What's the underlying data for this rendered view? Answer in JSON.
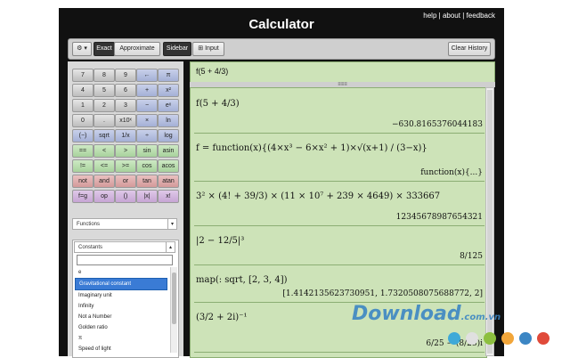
{
  "header": {
    "title": "Calculator",
    "links": [
      "help",
      "about",
      "feedback"
    ],
    "separator": "|"
  },
  "toolbar": {
    "gear": "⚙ ▾",
    "exact": "Exact",
    "approximate": "Approximate",
    "sidebar": "Sidebar",
    "input": "⊞ Input",
    "clear_history": "Clear History"
  },
  "keypad": {
    "keys": [
      "7",
      "8",
      "9",
      "←",
      "π",
      "4",
      "5",
      "6",
      "+",
      "x²",
      "1",
      "2",
      "3",
      "−",
      "eˣ",
      "0",
      ".",
      "x10ˣ",
      "×",
      "ln",
      "(−)",
      "sqrt",
      "1/x",
      "÷",
      "log",
      "==",
      "<",
      ">",
      "sin",
      "asin",
      "!=",
      "<=",
      ">=",
      "cos",
      "acos",
      "not",
      "and",
      "or",
      "tan",
      "atan",
      "f=g",
      "op",
      "()",
      "|x|",
      "x!"
    ]
  },
  "functions_dropdown": "Functions",
  "constants": {
    "label": "Constants",
    "items": [
      "e",
      "Gravitational constant",
      "Imaginary unit",
      "Infinity",
      "Not a Number",
      "Golden ratio",
      "π",
      "Speed of light"
    ],
    "selected_index": 1
  },
  "input_value": "f(5 + 4/3)",
  "divider_glyph": "≡≡≡",
  "results": [
    {
      "expr": "f(5 + 4/3)",
      "out": "−630.8165376044183"
    },
    {
      "expr": "f = function(x){(4×x³ − 6×x² + 1)×√(x+1) / (3−x)}",
      "out": "function(x){...}"
    },
    {
      "expr": "3² × (4! + 39/3) × (11 × 10⁷ + 239 × 4649) × 333667",
      "out": "12345678987654321"
    },
    {
      "expr": "|2 − 12/5|³",
      "out": "8/125"
    },
    {
      "expr": "map(: sqrt, [2, 3, 4])",
      "out": "[1.4142135623730951, 1.7320508075688772, 2]"
    },
    {
      "expr": "(3/2 + 2i)⁻¹",
      "out": "6/25 − (8/25)i"
    }
  ],
  "watermark": {
    "text": "Download",
    "suffix": ".com.vn"
  },
  "colors": {
    "result_bg": "#cde3b8",
    "accent_blue": "#3a7bd5",
    "dots": [
      "#3fa9d8",
      "#e0e0e0",
      "#8cbf3f",
      "#f2a63a",
      "#3c86c4",
      "#e04a3a"
    ]
  }
}
